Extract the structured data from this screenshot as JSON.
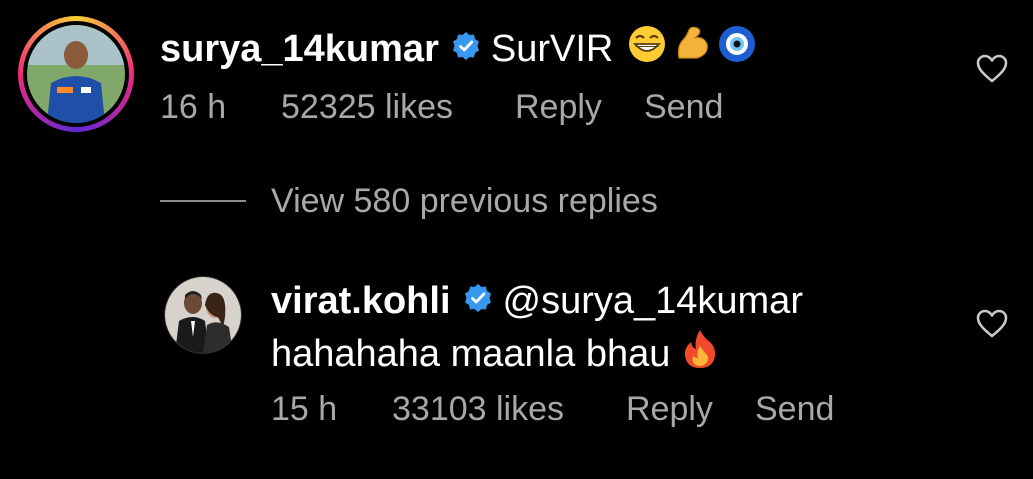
{
  "comments": [
    {
      "username": "surya_14kumar",
      "verified": true,
      "text": "SurVIR",
      "emojis": [
        "grinning-face-emoji",
        "flexed-biceps-emoji",
        "nazar-amulet-emoji"
      ],
      "time": "16 h",
      "likes": "52325 likes",
      "reply_label": "Reply",
      "send_label": "Send",
      "has_story_ring": true
    },
    {
      "username": "virat.kohli",
      "verified": true,
      "mention": "@surya_14kumar",
      "text": "hahahaha maanla bhau",
      "emojis": [
        "fire-emoji"
      ],
      "time": "15 h",
      "likes": "33103 likes",
      "reply_label": "Reply",
      "send_label": "Send",
      "has_story_ring": false
    }
  ],
  "view_replies": "View 580 previous replies",
  "colors": {
    "background": "#000000",
    "primary_text": "#ffffff",
    "secondary_text": "#a8a8a8",
    "verified_badge": "#3897f0"
  }
}
